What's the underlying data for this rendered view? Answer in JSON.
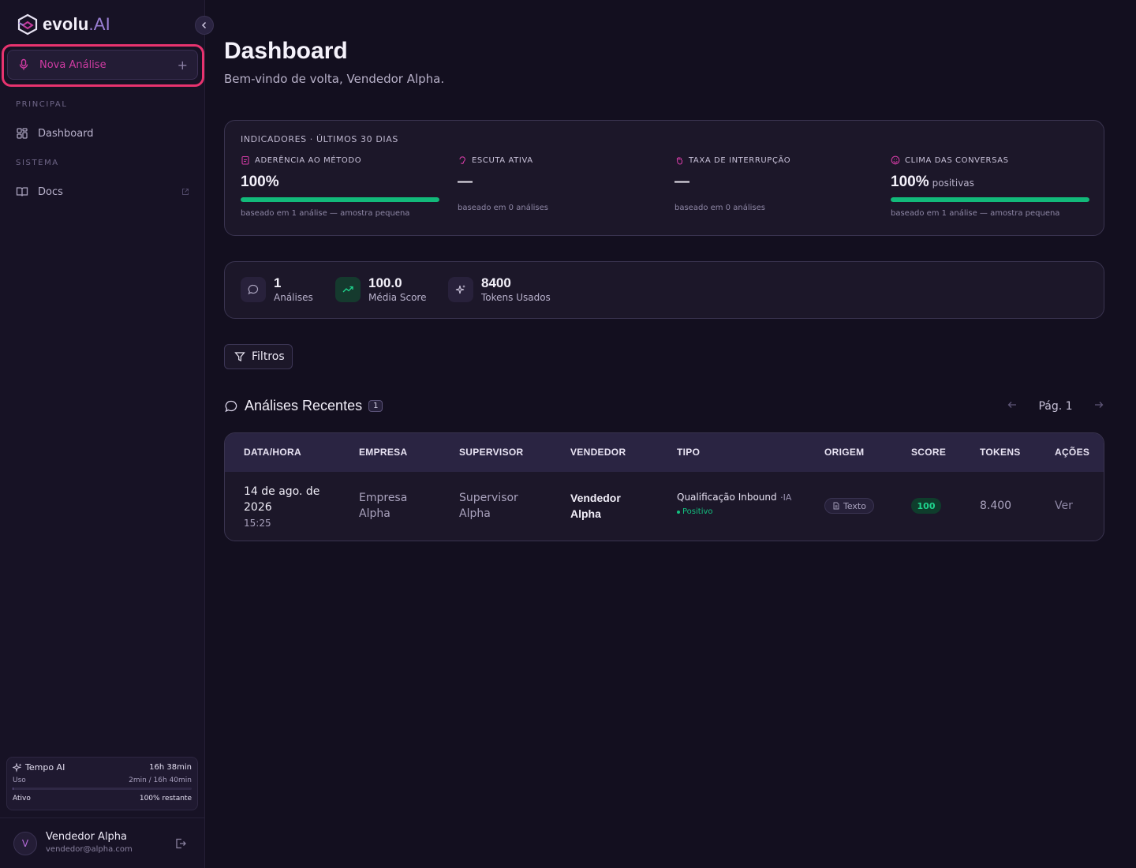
{
  "brand": {
    "logo_main": "evolu",
    "logo_suffix": ".AI"
  },
  "sidebar": {
    "new_analysis_label": "Nova Análise",
    "new_analysis_plus": "+",
    "sections": [
      {
        "label": "PRINCIPAL",
        "items": [
          {
            "label": "Dashboard",
            "icon": "grid-icon"
          }
        ]
      },
      {
        "label": "SISTEMA",
        "items": [
          {
            "label": "Docs",
            "icon": "book-icon"
          }
        ]
      }
    ],
    "usage": {
      "title": "Tempo AI",
      "total": "16h 38min",
      "usage_label": "Uso",
      "usage_value": "2min / 16h 40min",
      "usage_fraction": 0.002,
      "status_label": "Ativo",
      "status_value": "100% restante"
    },
    "user": {
      "initial": "V",
      "name": "Vendedor Alpha",
      "email": "vendedor@alpha.com"
    }
  },
  "header": {
    "title": "Dashboard",
    "subtitle": "Bem-vindo de volta, Vendedor Alpha."
  },
  "indicators": {
    "heading": "INDICADORES · ÚLTIMOS 30 DIAS",
    "items": [
      {
        "title": "ADERÊNCIA AO MÉTODO",
        "icon": "clipboard-icon",
        "value": "100%",
        "suffix": "",
        "progress": 1.0,
        "note": "baseado em 1 análise — amostra pequena"
      },
      {
        "title": "ESCUTA ATIVA",
        "icon": "ear-icon",
        "value": "—",
        "suffix": "",
        "progress": null,
        "note": "baseado em 0 análises"
      },
      {
        "title": "TAXA DE INTERRUPÇÃO",
        "icon": "hand-icon",
        "value": "—",
        "suffix": "",
        "progress": null,
        "note": "baseado em 0 análises"
      },
      {
        "title": "CLIMA DAS CONVERSAS",
        "icon": "smile-icon",
        "value": "100%",
        "suffix": "positivas",
        "progress": 1.0,
        "note": "baseado em 1 análise — amostra pequena"
      }
    ]
  },
  "stats": [
    {
      "value": "1",
      "label": "Análises",
      "icon": "chat-icon"
    },
    {
      "value": "100.0",
      "label": "Média Score",
      "icon": "trending-up-icon"
    },
    {
      "value": "8400",
      "label": "Tokens Usados",
      "icon": "sparkles-icon"
    }
  ],
  "filters_label": "Filtros",
  "recent": {
    "title": "Análises Recentes",
    "count": "1",
    "page_label": "Pág. 1",
    "columns": [
      "DATA/HORA",
      "EMPRESA",
      "SUPERVISOR",
      "VENDEDOR",
      "TIPO",
      "ORIGEM",
      "SCORE",
      "TOKENS",
      "AÇÕES"
    ],
    "rows": [
      {
        "date_line1": "14 de ago. de",
        "date_line2": "2026",
        "time": "15:25",
        "empresa_1": "Empresa",
        "empresa_2": "Alpha",
        "supervisor_1": "Supervisor",
        "supervisor_2": "Alpha",
        "vendedor_1": "Vendedor",
        "vendedor_2": "Alpha",
        "tipo": "Qualificação Inbound",
        "tipo_tag": "·IA",
        "sentiment": "Positivo",
        "origem": "Texto",
        "score": "100",
        "tokens": "8.400",
        "action": "Ver"
      }
    ]
  },
  "colors": {
    "accent_pink": "#d03ba3",
    "highlight": "#e8336f",
    "success": "#12b97a"
  }
}
